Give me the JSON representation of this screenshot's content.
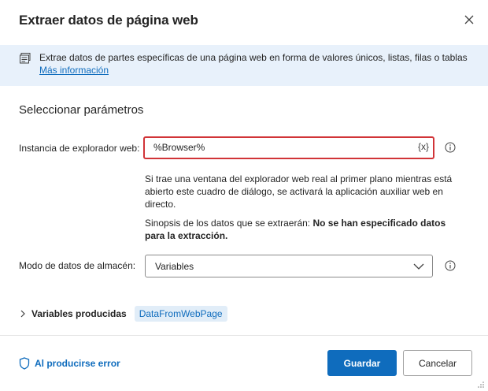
{
  "dialog": {
    "title": "Extraer datos de página web",
    "close_label": "✕"
  },
  "info": {
    "text": "Extrae datos de partes específicas de una página web en forma de valores únicos, listas, filas o tablas",
    "link": "Más información"
  },
  "section": {
    "title": "Seleccionar parámetros"
  },
  "browser": {
    "label": "Instancia de explorador web:",
    "value": "%Browser%",
    "var_button": "{x}",
    "help_text": "Si trae una ventana del explorador web real al primer plano mientras está abierto este cuadro de diálogo, se activará la aplicación auxiliar web en directo.",
    "preview_label": "Sinopsis de los datos que se extraerán: ",
    "preview_value": "No se han especificado datos para la extracción."
  },
  "storage": {
    "label": "Modo de datos de almacén:",
    "value": "Variables"
  },
  "variables": {
    "label": "Variables producidas",
    "chip": "DataFromWebPage"
  },
  "footer": {
    "error_label": "Al producirse error",
    "save_label": "Guardar",
    "cancel_label": "Cancelar"
  },
  "colors": {
    "accent": "#0f6cbd",
    "error_border": "#d13438",
    "banner_bg": "#e8f1fb"
  },
  "icons": {
    "banner": "form-icon",
    "close": "close-icon",
    "help": "info-circle-icon",
    "chevron": "chevron-down-icon",
    "expand": "chevron-right-icon",
    "error": "shield-icon"
  }
}
